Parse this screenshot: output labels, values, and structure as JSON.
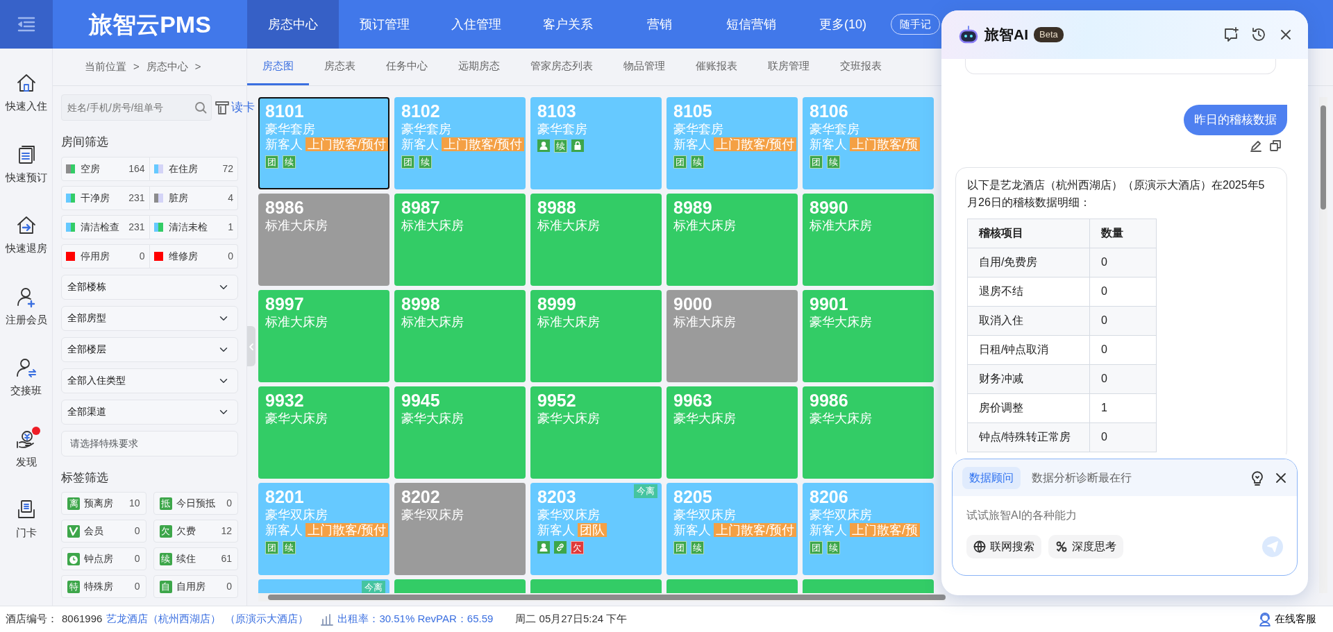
{
  "topbar": {
    "logo": "旅智云PMS",
    "nav": [
      {
        "label": "房态中心",
        "selected": true
      },
      {
        "label": "预订管理",
        "selected": false
      },
      {
        "label": "入住管理",
        "selected": false
      },
      {
        "label": "客户关系",
        "selected": false
      },
      {
        "label": "营销",
        "selected": false
      },
      {
        "label": "短信营销",
        "selected": false
      },
      {
        "label": "更多(10)",
        "selected": false
      }
    ],
    "memo_button": "随手记"
  },
  "quick_actions": [
    {
      "label": "快速入住",
      "alert": false
    },
    {
      "label": "快速预订",
      "alert": false
    },
    {
      "label": "快速退房",
      "alert": false
    },
    {
      "label": "注册会员",
      "alert": false
    },
    {
      "label": "交接班",
      "alert": false
    },
    {
      "label": "发现",
      "alert": true
    },
    {
      "label": "门卡",
      "alert": false
    }
  ],
  "breadcrumb": [
    "当前位置",
    ">",
    "房态中心",
    ">"
  ],
  "search": {
    "placeholder": "姓名/手机/房号/组单号",
    "card_button": "读卡"
  },
  "room_filter": {
    "title": "房间筛选",
    "items": [
      {
        "label": "空房",
        "count": "164",
        "swatches": [
          {
            "color": "#8c8c8c"
          },
          {
            "color": "#33cc66"
          }
        ]
      },
      {
        "label": "在住房",
        "count": "72",
        "swatches": [
          {
            "color": "#66c9ff"
          },
          {
            "color": "#d4d4f7"
          }
        ]
      },
      {
        "label": "干净房",
        "count": "231",
        "swatches": [
          {
            "color": "#66c9ff"
          },
          {
            "color": "#33cc66"
          }
        ]
      },
      {
        "label": "脏房",
        "count": "4",
        "swatches": [
          {
            "color": "#8c8c8c"
          },
          {
            "color": "#d4d4f7"
          }
        ]
      },
      {
        "label": "清洁检查",
        "count": "231",
        "swatches": [
          {
            "color": "#66c9ff"
          },
          {
            "color": "#33cc66"
          }
        ]
      },
      {
        "label": "清洁未检",
        "count": "1",
        "swatches": [
          {
            "color": "#66c9ff"
          },
          {
            "color": "#33cc66"
          }
        ]
      },
      {
        "label": "停用房",
        "count": "0",
        "swatches": [
          {
            "color": "#ff0000"
          }
        ]
      },
      {
        "label": "维修房",
        "count": "0",
        "swatches": [
          {
            "color": "#ff0000"
          }
        ]
      }
    ]
  },
  "selects": [
    "全部楼栋",
    "全部房型",
    "全部楼层",
    "全部入住类型",
    "全部渠道"
  ],
  "special_request": {
    "placeholder": "请选择特殊要求"
  },
  "tag_filter": {
    "title": "标签筛选",
    "items": [
      {
        "kind": "glyph",
        "tag": "离",
        "label": "预离房",
        "count": "10"
      },
      {
        "kind": "glyph",
        "tag": "抵",
        "label": "今日预抵",
        "count": "0"
      },
      {
        "kind": "vip",
        "label": "会员",
        "count": "0"
      },
      {
        "kind": "glyph",
        "tag": "欠",
        "label": "欠费",
        "count": "12"
      },
      {
        "kind": "clock",
        "label": "钟点房",
        "count": "0"
      },
      {
        "kind": "glyph",
        "tag": "续",
        "label": "续住",
        "count": "61"
      },
      {
        "kind": "glyph",
        "tag": "特",
        "label": "特殊房",
        "count": "0"
      },
      {
        "kind": "glyph",
        "tag": "自",
        "label": "自用房",
        "count": "0"
      }
    ]
  },
  "subtabs": [
    {
      "label": "房态图",
      "selected": true
    },
    {
      "label": "房态表",
      "selected": false
    },
    {
      "label": "任务中心",
      "selected": false
    },
    {
      "label": "远期房态",
      "selected": false
    },
    {
      "label": "管家房态列表",
      "selected": false
    },
    {
      "label": "物品管理",
      "selected": false
    },
    {
      "label": "催账报表",
      "selected": false
    },
    {
      "label": "联房管理",
      "selected": false
    },
    {
      "label": "交班报表",
      "selected": false
    }
  ],
  "rooms": [
    {
      "number": "8101",
      "type": "豪华套房",
      "color": "#66c9ff",
      "guest": "新客人",
      "source": "上门散客/预付",
      "badges": [
        {
          "kind": "text",
          "text": "团",
          "color": "#3da64a"
        },
        {
          "kind": "text",
          "text": "续",
          "color": "#3da64a"
        }
      ],
      "selected": true
    },
    {
      "number": "8102",
      "type": "豪华套房",
      "color": "#66c9ff",
      "guest": "新客人",
      "source": "上门散客/预付",
      "badges": [
        {
          "kind": "text",
          "text": "团",
          "color": "#3da64a"
        },
        {
          "kind": "text",
          "text": "续",
          "color": "#3da64a"
        }
      ],
      "selected": false
    },
    {
      "number": "8103",
      "type": "豪华套房",
      "color": "#66c9ff",
      "badges": [
        {
          "kind": "person",
          "color": "#3da64a"
        },
        {
          "kind": "text",
          "text": "续",
          "color": "#3da64a"
        },
        {
          "kind": "lock",
          "color": "#3da64a"
        }
      ],
      "selected": false
    },
    {
      "number": "8105",
      "type": "豪华套房",
      "color": "#66c9ff",
      "guest": "新客人",
      "source": "上门散客/预付",
      "badges": [
        {
          "kind": "text",
          "text": "团",
          "color": "#3da64a"
        },
        {
          "kind": "text",
          "text": "续",
          "color": "#3da64a"
        }
      ],
      "selected": false
    },
    {
      "number": "8106",
      "type": "豪华套房",
      "color": "#66c9ff",
      "guest": "新客人",
      "source": "上门散客/预",
      "badges": [
        {
          "kind": "text",
          "text": "团",
          "color": "#3da64a"
        },
        {
          "kind": "text",
          "text": "续",
          "color": "#3da64a"
        }
      ],
      "selected": false
    },
    {
      "number": "8986",
      "type": "标准大床房",
      "color": "#9b9b9b",
      "selected": false
    },
    {
      "number": "8987",
      "type": "标准大床房",
      "color": "#33cc66",
      "selected": false
    },
    {
      "number": "8988",
      "type": "标准大床房",
      "color": "#33cc66",
      "selected": false
    },
    {
      "number": "8989",
      "type": "标准大床房",
      "color": "#33cc66",
      "selected": false
    },
    {
      "number": "8990",
      "type": "标准大床房",
      "color": "#33cc66",
      "selected": false
    },
    {
      "number": "8997",
      "type": "标准大床房",
      "color": "#33cc66",
      "selected": false
    },
    {
      "number": "8998",
      "type": "标准大床房",
      "color": "#33cc66",
      "selected": false
    },
    {
      "number": "8999",
      "type": "标准大床房",
      "color": "#33cc66",
      "selected": false
    },
    {
      "number": "9000",
      "type": "标准大床房",
      "color": "#9b9b9b",
      "selected": false
    },
    {
      "number": "9901",
      "type": "豪华大床房",
      "color": "#33cc66",
      "selected": false
    },
    {
      "number": "9932",
      "type": "豪华大床房",
      "color": "#33cc66",
      "selected": false
    },
    {
      "number": "9945",
      "type": "豪华大床房",
      "color": "#33cc66",
      "selected": false
    },
    {
      "number": "9952",
      "type": "豪华大床房",
      "color": "#33cc66",
      "selected": false
    },
    {
      "number": "9963",
      "type": "豪华大床房",
      "color": "#33cc66",
      "selected": false
    },
    {
      "number": "9986",
      "type": "豪华大床房",
      "color": "#33cc66",
      "selected": false
    },
    {
      "number": "8201",
      "type": "豪华双床房",
      "color": "#66c9ff",
      "guest": "新客人",
      "source": "上门散客/预付",
      "badges": [
        {
          "kind": "text",
          "text": "团",
          "color": "#3da64a"
        },
        {
          "kind": "text",
          "text": "续",
          "color": "#3da64a"
        }
      ],
      "selected": false
    },
    {
      "number": "8202",
      "type": "豪华双床房",
      "color": "#9b9b9b",
      "selected": false
    },
    {
      "number": "8203",
      "type": "豪华双床房",
      "color": "#66c9ff",
      "guest": "新客人",
      "source": "团队",
      "leaving": "今离",
      "badges": [
        {
          "kind": "person",
          "color": "#3da64a"
        },
        {
          "kind": "link",
          "color": "#3da64a"
        },
        {
          "kind": "text",
          "text": "欠",
          "color": "#e03a3a"
        }
      ],
      "selected": false
    },
    {
      "number": "8205",
      "type": "豪华双床房",
      "color": "#66c9ff",
      "guest": "新客人",
      "source": "上门散客/预付",
      "badges": [
        {
          "kind": "text",
          "text": "团",
          "color": "#3da64a"
        },
        {
          "kind": "text",
          "text": "续",
          "color": "#3da64a"
        }
      ],
      "selected": false
    },
    {
      "number": "8206",
      "type": "豪华双床房",
      "color": "#66c9ff",
      "guest": "新客人",
      "source": "上门散客/预",
      "badges": [
        {
          "kind": "text",
          "text": "团",
          "color": "#3da64a"
        },
        {
          "kind": "text",
          "text": "续",
          "color": "#3da64a"
        }
      ],
      "selected": false
    },
    {
      "color": "#66c9ff",
      "leaving": "今离",
      "selected": false
    },
    {
      "color": "#33cc66",
      "selected": false
    },
    {
      "color": "#33cc66",
      "selected": false
    },
    {
      "color": "#33cc66",
      "selected": false
    },
    {
      "color": "#33cc66",
      "selected": false
    }
  ],
  "ai_panel": {
    "title": "旅智AI",
    "badge": "Beta",
    "user_message": "昨日的稽核数据",
    "reply": {
      "text": "以下是艺龙酒店（杭州西湖店）（原演示大酒店）在2025年5月26日的稽核数据明细：",
      "table": {
        "columns": [
          "稽核项目",
          "数量"
        ],
        "rows": [
          [
            "自用/免费房",
            "0"
          ],
          [
            "退房不结",
            "0"
          ],
          [
            "取消入住",
            "0"
          ],
          [
            "日租/钟点取消",
            "0"
          ],
          [
            "财务冲减",
            "0"
          ],
          [
            "房价调整",
            "1"
          ],
          [
            "钟点/特殊转正常房",
            "0"
          ]
        ]
      }
    },
    "composer": {
      "modes": [
        {
          "label": "数据顾问",
          "selected": true
        }
      ],
      "mode_hint": "数据分析诊断最在行",
      "placeholder": "试试旅智AI的各种能力",
      "tools": [
        "联网搜索",
        "深度思考"
      ],
      "send_disabled": true
    }
  },
  "status_bar": {
    "hotel_code_label": "酒店编号：",
    "hotel_code": "8061996",
    "hotel_name": "艺龙酒店（杭州西湖店）",
    "hotel_alias": "（原演示大酒店）",
    "occupancy": "出租率：30.51% RevPAR：65.59",
    "datetime": "周二 05月27日5:24 下午",
    "support": "在线客服"
  }
}
